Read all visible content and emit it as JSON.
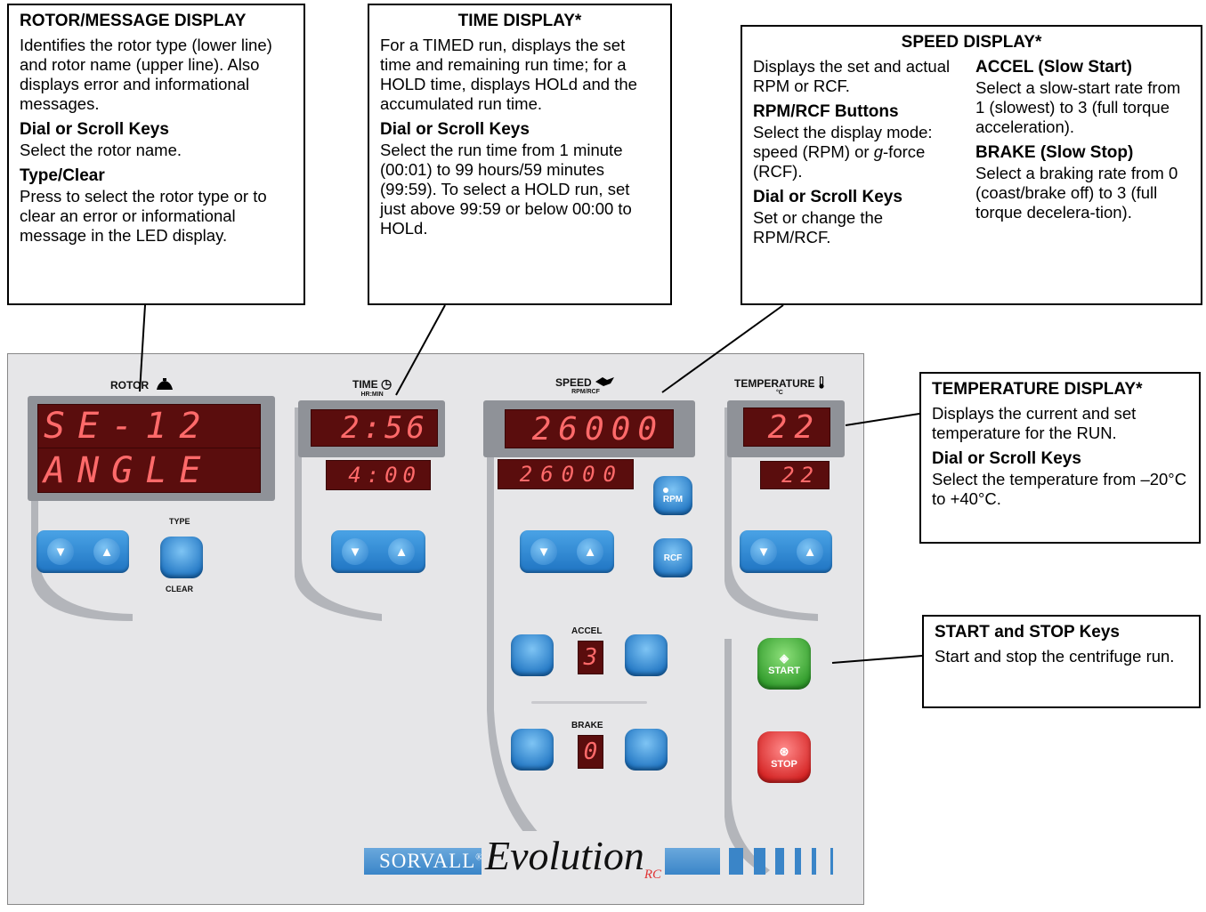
{
  "callouts": {
    "rotor": {
      "title": "ROTOR/MESSAGE DISPLAY",
      "text": "Identifies the rotor type (lower line) and rotor name (upper line). Also displays error and informational messages.",
      "h2": "Dial or Scroll Keys",
      "t2": "Select the rotor name.",
      "h3": "Type/Clear",
      "t3": "Press to select the rotor type or to clear an error or informational message in the LED display."
    },
    "time": {
      "title": "TIME DISPLAY*",
      "text": "For a TIMED run, displays the set time and remaining run time; for a HOLD time, displays HOLd and the accumulated run time.",
      "h2": "Dial or Scroll Keys",
      "t2": "Select the run time from 1 minute (00:01) to 99 hours/59 minutes (99:59). To select a HOLD run, set just above 99:59 or below 00:00 to HOLd."
    },
    "speed": {
      "title": "SPEED DISPLAY*",
      "text": "Displays the set and actual RPM or RCF.",
      "h2": "RPM/RCF Buttons",
      "t2a": "Select the display mode: speed (RPM) or ",
      "t2g": "g",
      "t2b": "-force (RCF).",
      "h3": "Dial or Scroll Keys",
      "t3": "Set or change the RPM/RCF.",
      "h4": "ACCEL (Slow Start)",
      "t4": "Select a slow-start rate from 1 (slowest) to 3 (full torque acceleration).",
      "h5": "BRAKE (Slow Stop)",
      "t5": "Select a braking rate from 0 (coast/brake off) to 3 (full torque decelera-tion)."
    },
    "temp": {
      "title": "TEMPERATURE DISPLAY*",
      "text": "Displays the current and set temperature for the RUN.",
      "h2": "Dial or Scroll Keys",
      "t2": "Select the temperature from –20°C to +40°C."
    },
    "startstop": {
      "title": "START and STOP Keys",
      "text": "Start and stop the centrifuge run."
    }
  },
  "panel": {
    "rotor": {
      "label": "ROTOR",
      "line1": "SE-12",
      "line2": "ANGLE",
      "type_label": "TYPE",
      "clear_label": "CLEAR"
    },
    "time": {
      "label": "TIME",
      "sublabel": "HR:MIN",
      "actual": "2:56",
      "set": "4:00"
    },
    "speed": {
      "label": "SPEED",
      "sublabel": "RPM/RCF",
      "actual": "26000",
      "set": "26000",
      "rpm": "RPM",
      "rcf": "RCF"
    },
    "temperature": {
      "label": "TEMPERATURE",
      "sublabel": "°C",
      "actual": "22",
      "set": "22"
    },
    "accel": {
      "label": "ACCEL",
      "value": "3"
    },
    "brake": {
      "label": "BRAKE",
      "value": "0"
    },
    "start_label": "START",
    "stop_label": "STOP",
    "brand": {
      "sorvall": "SORVALL",
      "reg": "®",
      "evolution": "Evolution",
      "rc": "RC"
    },
    "icons": {
      "down": "▼",
      "up": "▲",
      "start": "◈",
      "stop": "⊛",
      "clock": "◷",
      "thermo": "thermometer-icon"
    }
  }
}
